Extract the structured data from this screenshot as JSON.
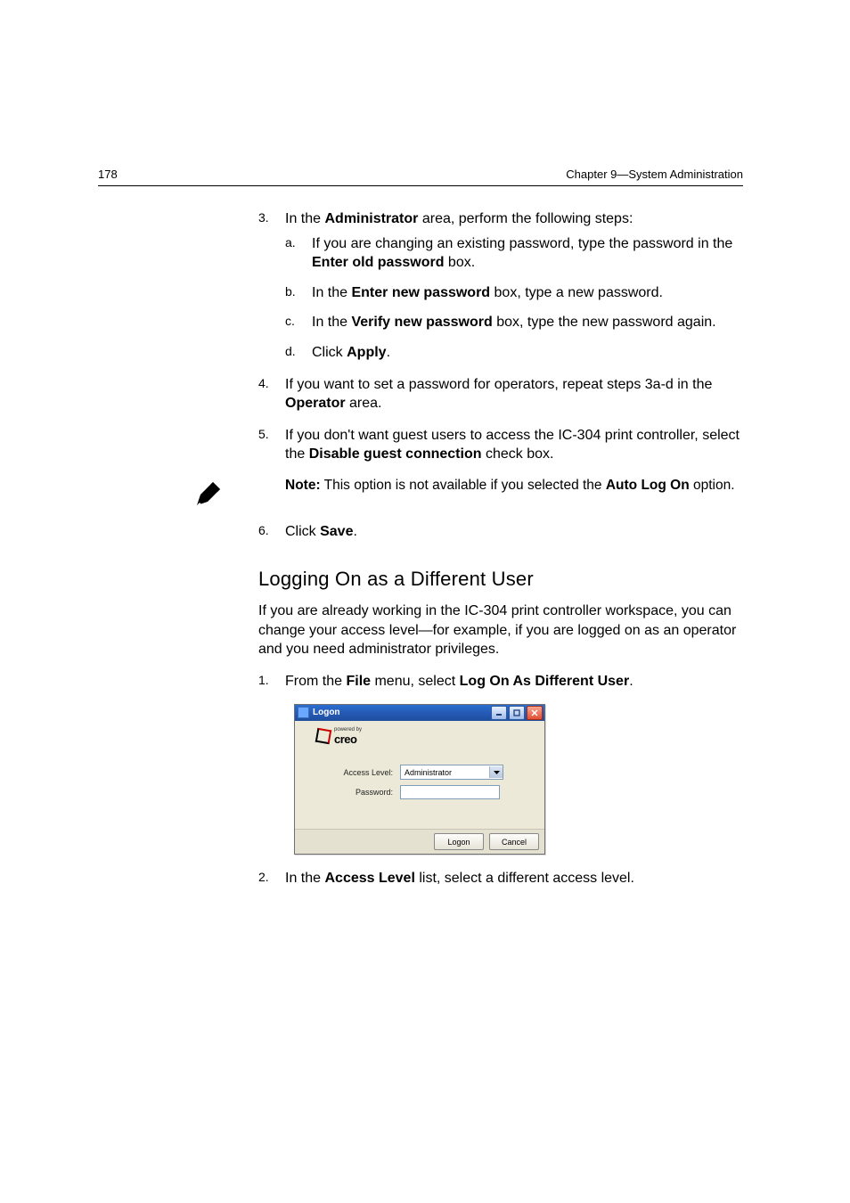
{
  "header": {
    "page_number": "178",
    "chapter": "Chapter 9—System Administration"
  },
  "step3": {
    "num": "3.",
    "prefix": "In the ",
    "bold1": "Administrator",
    "suffix": " area, perform the following steps:",
    "a": {
      "num": "a.",
      "t1": "If you are changing an existing password, type the password in the ",
      "b1": "Enter old password",
      "t2": " box."
    },
    "b": {
      "num": "b.",
      "t1": "In the ",
      "b1": "Enter new password",
      "t2": " box, type a new password."
    },
    "c": {
      "num": "c.",
      "t1": "In the ",
      "b1": "Verify new password",
      "t2": " box, type the new password again."
    },
    "d": {
      "num": "d.",
      "t1": "Click ",
      "b1": "Apply",
      "t2": "."
    }
  },
  "step4": {
    "num": "4.",
    "t1": "If you want to set a password for operators, repeat steps 3a-d in the ",
    "b1": "Operator",
    "t2": " area."
  },
  "step5": {
    "num": "5.",
    "t1": "If you don't want guest users to access the IC-304 print controller, select the ",
    "b1": "Disable guest connection",
    "t2": " check box."
  },
  "note": {
    "b1": "Note:",
    "t1": "  This option is not available if you selected the ",
    "b2": "Auto Log On",
    "t2": " option."
  },
  "step6": {
    "num": "6.",
    "t1": "Click ",
    "b1": "Save",
    "t2": "."
  },
  "section_heading": "Logging On as a Different User",
  "section_intro": "If you are already working in the IC-304 print controller workspace, you can change your access level—for example, if you are logged on as an operator and you need administrator privileges.",
  "bstep1": {
    "num": "1.",
    "t1": "From the ",
    "b1": "File",
    "t2": " menu, select ",
    "b2": "Log On As Different User",
    "t3": "."
  },
  "dialog": {
    "title": "Logon",
    "powered_by": "powered by",
    "brand": "creo",
    "access_label": "Access Level:",
    "access_value": "Administrator",
    "password_label": "Password:",
    "logon_btn": "Logon",
    "cancel_btn": "Cancel"
  },
  "bstep2": {
    "num": "2.",
    "t1": "In the ",
    "b1": "Access Level",
    "t2": " list, select a different access level."
  }
}
